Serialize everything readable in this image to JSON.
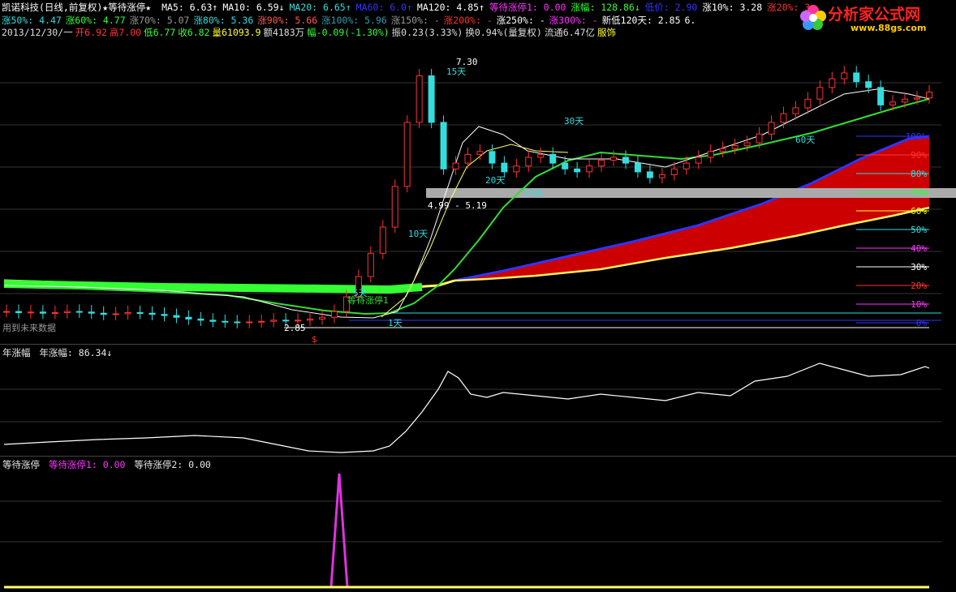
{
  "header": {
    "stock_title": "凯诺科技(日线,前复权)★等待涨停★",
    "ma_items": [
      {
        "label": "MA5: 6.63↑",
        "color": "#ffffff"
      },
      {
        "label": "MA10: 6.59↓",
        "color": "#ffffff"
      },
      {
        "label": "MA20: 6.65↑",
        "color": "#33dddd"
      },
      {
        "label": "MA60: 6.0↑",
        "color": "#3333ff"
      },
      {
        "label": "MA120: 4.85↑",
        "color": "#ffffff"
      },
      {
        "label": "等待涨停1: 0.00",
        "color": "#ff33ff"
      },
      {
        "label": "涨幅: 128.86↓",
        "color": "#33ff33"
      },
      {
        "label": "低价: 2.90",
        "color": "#3333ff"
      },
      {
        "label": "涨10%: 3.28",
        "color": "#ffffff"
      },
      {
        "label": "涨20%: 3.",
        "color": "#ff3333"
      }
    ],
    "row2_items": [
      {
        "label": "涨50%: 4.47",
        "color": "#33dddd"
      },
      {
        "label": "涨60%: 4.77",
        "color": "#33ff33"
      },
      {
        "label": "涨70%: 5.07",
        "color": "#999999"
      },
      {
        "label": "涨80%: 5.36",
        "color": "#33dddd"
      },
      {
        "label": "涨90%: 5.66",
        "color": "#ff5555"
      },
      {
        "label": "涨100%: 5.96",
        "color": "#3399aa"
      },
      {
        "label": "涨150%: -",
        "color": "#999999"
      },
      {
        "label": "涨200%: -",
        "color": "#ff3333"
      },
      {
        "label": "涨250%: -",
        "color": "#ffffff"
      },
      {
        "label": "涨300%: -",
        "color": "#ff33ff"
      },
      {
        "label": "新低120天: 2.85",
        "color": "#ffffff"
      },
      {
        "label": "6.",
        "color": "#ffffff"
      }
    ],
    "row3_items": [
      {
        "label": "2013/12/30/一",
        "color": "#dddddd"
      },
      {
        "label": "开6.92",
        "color": "#ff3333"
      },
      {
        "label": "高7.00",
        "color": "#ff3333"
      },
      {
        "label": "低6.77",
        "color": "#33ff33"
      },
      {
        "label": "收6.82",
        "color": "#33ff33"
      },
      {
        "label": "量61093.9",
        "color": "#ffff33"
      },
      {
        "label": "额4183万",
        "color": "#dddddd"
      },
      {
        "label": "幅-0.09(-1.30%)",
        "color": "#33ff33"
      },
      {
        "label": "振0.23(3.33%)",
        "color": "#dddddd"
      },
      {
        "label": "换0.94%(量复权)",
        "color": "#dddddd"
      },
      {
        "label": "流通6.47亿",
        "color": "#dddddd"
      },
      {
        "label": "服饰",
        "color": "#ffff33"
      }
    ]
  },
  "logo": {
    "text": "分析家公式网",
    "url_text": "www.88gs.com"
  },
  "main_panel": {
    "annotations": {
      "peak": "7.30",
      "day15": "15天",
      "day30": "30天",
      "day20": "20天",
      "day25": "25天",
      "day60": "60天",
      "day10": "10天",
      "range": "4.99 - 5.19",
      "day5": "5天",
      "day1": "1天",
      "wait_label": "等待涨停1",
      "low": "2.85",
      "future_note": "用到未来数据",
      "dollar": "$"
    },
    "pct_levels": [
      "100%",
      "90%",
      "80%",
      "70%",
      "60%",
      "50%",
      "40%",
      "30%",
      "20%",
      "10%",
      "0%"
    ],
    "pct_colors": [
      "#3333ff",
      "#ff3333",
      "#33dddd",
      "#33ff33",
      "#ffff33",
      "#33dddd",
      "#ff33ff",
      "#ffffff",
      "#ff3333",
      "#ff33ff",
      "#3333ff"
    ]
  },
  "panel2": {
    "title": "年涨幅",
    "value_label": "年涨幅: 86.34↓"
  },
  "panel3": {
    "title": "等待涨停",
    "s1": "等待涨停1: 0.00",
    "s2": "等待涨停2: 0.00"
  },
  "chart_data": [
    {
      "type": "candlestick",
      "title": "凯诺科技(日线,前复权)",
      "series": [
        {
          "name": "MA5",
          "current": 6.63
        },
        {
          "name": "MA10",
          "current": 6.59
        },
        {
          "name": "MA20",
          "current": 6.65
        },
        {
          "name": "MA60",
          "current": 6.0
        },
        {
          "name": "MA120",
          "current": 4.85
        }
      ],
      "close_approx": [
        3.05,
        3.03,
        3.04,
        3.02,
        3.03,
        3.05,
        3.04,
        3.02,
        3.0,
        3.01,
        3.03,
        3.02,
        3.0,
        2.98,
        2.95,
        2.92,
        2.9,
        2.88,
        2.87,
        2.86,
        2.87,
        2.88,
        2.9,
        2.89,
        2.9,
        2.92,
        2.95,
        3.05,
        3.3,
        3.65,
        4.05,
        4.5,
        5.2,
        6.3,
        7.1,
        6.3,
        5.5,
        5.6,
        5.75,
        5.8,
        5.6,
        5.45,
        5.55,
        5.7,
        5.75,
        5.6,
        5.5,
        5.45,
        5.55,
        5.65,
        5.7,
        5.6,
        5.45,
        5.35,
        5.4,
        5.5,
        5.6,
        5.7,
        5.8,
        5.85,
        5.9,
        5.95,
        6.1,
        6.3,
        6.45,
        6.55,
        6.7,
        6.9,
        7.05,
        7.15,
        7.0,
        6.9,
        6.6,
        6.65,
        6.7,
        6.72,
        6.82
      ],
      "levels": {
        "high": 7.3,
        "low": 2.85,
        "range_low": 4.99,
        "range_high": 5.19
      }
    },
    {
      "type": "line",
      "title": "年涨幅",
      "series": [
        {
          "name": "年涨幅",
          "current": 86.34
        }
      ]
    },
    {
      "type": "line",
      "title": "等待涨停",
      "series": [
        {
          "name": "等待涨停1",
          "current": 0.0
        },
        {
          "name": "等待涨停2",
          "current": 0.0
        }
      ]
    }
  ]
}
